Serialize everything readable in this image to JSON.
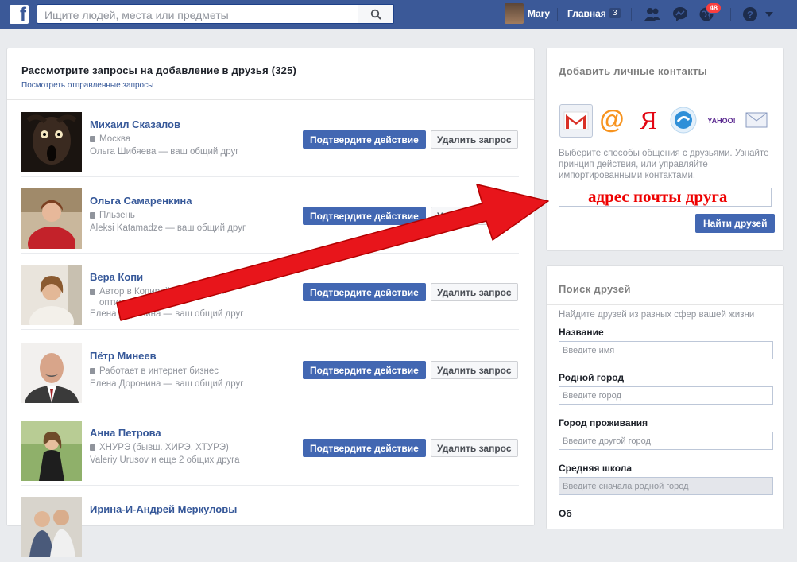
{
  "topbar": {
    "logo_letter": "f",
    "search_placeholder": "Ищите людей, места или предметы",
    "user_name": "Mary",
    "home_label": "Главная",
    "home_count": "3",
    "notifications_count": "48",
    "bar_color": "#3b5998"
  },
  "requests": {
    "title": "Рассмотрите запросы на добавление в друзья (325)",
    "sent_link": "Посмотреть отправленные запросы",
    "confirm_label": "Подтвердите действие",
    "delete_label": "Удалить запрос",
    "items": [
      {
        "name": "Михаил Сказалов",
        "line1": "Москва",
        "line2": "Ольга Шибяева — ваш общий друг",
        "line3": "",
        "avatar_icon": "scary-mask-avatar-icon"
      },
      {
        "name": "Ольга Самаренкина",
        "line1": "Пльзень",
        "line2": "Aleksi Katamadze — ваш общий друг",
        "line3": "",
        "avatar_icon": "woman-red-dress-avatar-icon"
      },
      {
        "name": "Вера Копи",
        "line1": "Автор в Копирайтинг, взбла…",
        "line2": "оптимизация",
        "line3": "Елена Доронина — ваш общий друг",
        "avatar_icon": "woman-avatar-icon"
      },
      {
        "name": "Пётр Минеев",
        "line1": "Работает в интернет бизнес",
        "line2": "Елена Доронина — ваш общий друг",
        "line3": "",
        "avatar_icon": "man-suit-avatar-icon"
      },
      {
        "name": "Анна Петрова",
        "line1": "ХНУРЭ (бывш. ХИРЭ, ХТУРЭ)",
        "line2": "Valeriy Urusov и еще 2 общих друга",
        "line3": "",
        "avatar_icon": "woman-outdoor-avatar-icon"
      },
      {
        "name": "Ирина-И-Андрей Меркуловы",
        "line1": "",
        "line2": "",
        "line3": "",
        "avatar_icon": "couple-avatar-icon"
      }
    ]
  },
  "contacts": {
    "title": "Добавить личные контакты",
    "providers": [
      "gmail-icon",
      "mail-ru-icon",
      "yandex-icon",
      "rambler-icon",
      "yahoo-icon",
      "other-email-icon"
    ],
    "yahoo_text": "YAHOO!",
    "yandex_letter": "Я",
    "mailru_symbol": "@",
    "description": "Выберите способы общения с друзьями. Узнайте принцип действия, или управляйте импортированными контактами.",
    "email_overlay": "адрес почты друга",
    "find_button": "Найти друзей"
  },
  "search": {
    "title": "Поиск друзей",
    "description": "Найдите друзей из разных сфер вашей жизни",
    "fields": [
      {
        "label": "Название",
        "placeholder": "Введите имя"
      },
      {
        "label": "Родной город",
        "placeholder": "Введите город"
      },
      {
        "label": "Город проживания",
        "placeholder": "Введите другой город"
      },
      {
        "label": "Средняя школа",
        "placeholder": "Введите сначала родной город"
      }
    ],
    "next_label": "Об"
  },
  "annotation": {
    "arrow_color": "#e8151b"
  }
}
